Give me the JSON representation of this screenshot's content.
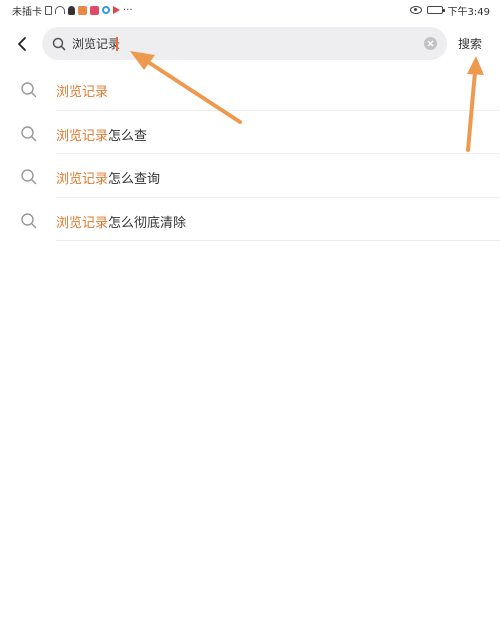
{
  "status_bar": {
    "carrier": "未插卡",
    "more": "···",
    "time": "下午3:49"
  },
  "search": {
    "value": "浏览记录",
    "button_label": "搜索"
  },
  "suggestions": [
    {
      "highlight": "浏览记录",
      "rest": ""
    },
    {
      "highlight": "浏览记录",
      "rest": "怎么查"
    },
    {
      "highlight": "浏览记录",
      "rest": "怎么查询"
    },
    {
      "highlight": "浏览记录",
      "rest": "怎么彻底清除"
    }
  ],
  "colors": {
    "highlight": "#e07a2e",
    "annotation_arrow": "#ee9a4e",
    "search_bg": "#eeeef0"
  },
  "icons": [
    "back-arrow-icon",
    "search-icon",
    "clear-icon",
    "eye-icon",
    "battery-icon",
    "wifi-icon"
  ]
}
